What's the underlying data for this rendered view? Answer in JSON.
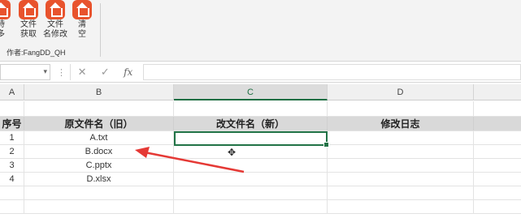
{
  "ribbon": {
    "buttons": [
      {
        "label": "時\n多",
        "icon": "home-folder-icon"
      },
      {
        "label": "文件\n获取",
        "icon": "home-folder-icon"
      },
      {
        "label": "文件\n名修改",
        "icon": "home-folder-icon"
      },
      {
        "label": "清\n空",
        "icon": "home-folder-icon"
      }
    ],
    "group_label": "作者:FangDD_QH",
    "accent": "#e8532d"
  },
  "formula_bar": {
    "name_box_value": "",
    "cancel_glyph": "✕",
    "confirm_glyph": "✓",
    "fx_glyph": "fx",
    "formula_value": ""
  },
  "columns": [
    "A",
    "B",
    "C",
    "D"
  ],
  "sheet": {
    "header": [
      "序号",
      "原文件名（旧）",
      "改文件名（新）",
      "修改日志"
    ],
    "rows": [
      [
        "1",
        "A.txt",
        "",
        ""
      ],
      [
        "2",
        "B.docx",
        "",
        ""
      ],
      [
        "3",
        "C.pptx",
        "",
        ""
      ],
      [
        "4",
        "D.xlsx",
        "",
        ""
      ]
    ]
  },
  "annotation": {
    "color": "#e53935"
  }
}
